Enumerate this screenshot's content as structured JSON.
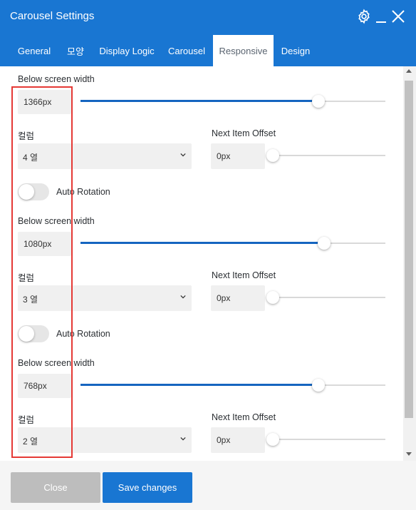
{
  "window": {
    "title": "Carousel Settings",
    "icons": [
      "gear-icon",
      "minimize-icon",
      "close-icon"
    ]
  },
  "tabs": [
    {
      "label": "General",
      "active": false
    },
    {
      "label": "모양",
      "active": false
    },
    {
      "label": "Display Logic",
      "active": false
    },
    {
      "label": "Carousel",
      "active": false
    },
    {
      "label": "Responsive",
      "active": true
    },
    {
      "label": "Design",
      "active": false
    }
  ],
  "sections": [
    {
      "width_label": "Below screen width",
      "width_value": "1366px",
      "width_slider_level": 0.78,
      "columns_label": "컬럼",
      "columns_value": "4 열",
      "offset_label": "Next Item Offset",
      "offset_value": "0px",
      "offset_slider_level": 0.0,
      "rotation_label": "Auto Rotation",
      "rotation_on": false
    },
    {
      "width_label": "Below screen width",
      "width_value": "1080px",
      "width_slider_level": 0.8,
      "columns_label": "컬럼",
      "columns_value": "3 열",
      "offset_label": "Next Item Offset",
      "offset_value": "0px",
      "offset_slider_level": 0.0,
      "rotation_label": "Auto Rotation",
      "rotation_on": false
    },
    {
      "width_label": "Below screen width",
      "width_value": "768px",
      "width_slider_level": 0.78,
      "columns_label": "컬럼",
      "columns_value": "2 열",
      "offset_label": "Next Item Offset",
      "offset_value": "0px",
      "offset_slider_level": 0.0
    }
  ],
  "footer": {
    "close_label": "Close",
    "save_label": "Save changes"
  },
  "colors": {
    "primary": "#1976d2",
    "slider_fill": "#1565c0",
    "highlight": "#e53935",
    "disabled_button": "#bdbdbd"
  }
}
